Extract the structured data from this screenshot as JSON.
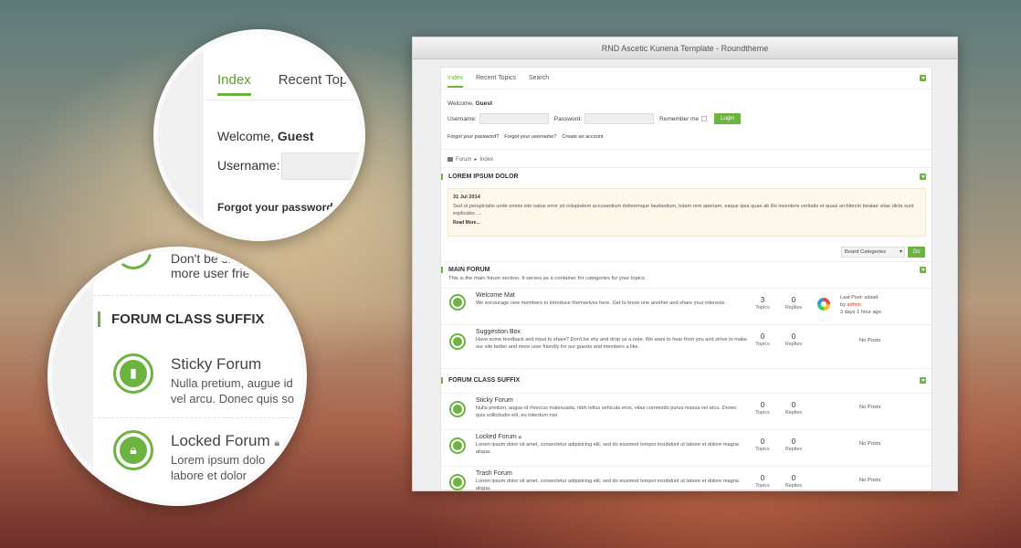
{
  "window": {
    "title": "RND Ascetic Kunena Template - Roundtheme"
  },
  "tabs": [
    {
      "label": "Index"
    },
    {
      "label": "Recent Topics"
    },
    {
      "label": "Search"
    }
  ],
  "login": {
    "welcome_prefix": "Welcome,",
    "welcome_user": "Guest",
    "username_label": "Username:",
    "password_label": "Password:",
    "remember_label": "Remember me",
    "login_button": "Login",
    "forgot_password": "Forgot your password?",
    "forgot_username": "Forgot your username?",
    "create_account": "Create an account"
  },
  "breadcrumb": {
    "forum": "Forum",
    "sep": "▸",
    "index": "Index"
  },
  "announcement": {
    "heading": "LOREM IPSUM DOLOR",
    "date": "31 Jul 2014",
    "text": "Sed ut perspiciatis unde omnis iste natus error sit voluptatem accusantium doloremque laudantium, totam rem aperiam, eaque ipsa quae ab illo inventore veritatis et quasi architecto beatae vitae dicta sunt explicabo. ...",
    "read_more": "Read More..."
  },
  "category_select": {
    "value": "Board Categories",
    "go_button": "Go"
  },
  "sections": [
    {
      "title": "MAIN FORUM",
      "description": "This is the main forum section. It serves as a container for categories for your topics.",
      "forums": [
        {
          "name": "Welcome Mat",
          "desc": "We encourage new members to introduce themselves here. Get to know one another and share your interests.",
          "topics": "3",
          "replies": "0",
          "last_post": "Last Post: sdasd",
          "by": "by",
          "author": "admin",
          "ago": "3 days 1 hour ago"
        },
        {
          "name": "Suggestion Box",
          "desc": "Have some feedback and input to share? Don't be shy and drop us a note. We want to hear from you and strive to make our site better and more user friendly for our guests and members a like.",
          "topics": "0",
          "replies": "0",
          "no_posts": "No Posts"
        }
      ]
    },
    {
      "title": "FORUM CLASS SUFFIX",
      "forums": [
        {
          "name": "Sticky Forum",
          "desc": "Nulla pretium, augue id rhoncus malesuada, nibh tellus vehicula eros, vitae commodo purus massa vel arcu. Donec quis sollicitudin elit, eu interdum nisl",
          "topics": "0",
          "replies": "0",
          "no_posts": "No Posts"
        },
        {
          "name": "Locked Forum",
          "desc": "Lorem ipsum dolor sit amet, consectetur adipisicing elit, sed do eiusmod tempor incididunt ut labore et dolore magna aliqua.",
          "topics": "0",
          "replies": "0",
          "no_posts": "No Posts"
        },
        {
          "name": "Trash Forum",
          "desc": "Lorem ipsum dolor sit amet, consectetur adipisicing elit, sed do eiusmod tempor incididunt ut labore et dolore magna aliqua.",
          "topics": "0",
          "replies": "0",
          "no_posts": "No Posts"
        }
      ]
    }
  ],
  "stat_labels": {
    "topics": "Topics",
    "replies": "Replies"
  },
  "zoom1": {
    "tab_index": "Index",
    "tab_recent": "Recent Topi",
    "welcome_prefix": "Welcome,",
    "welcome_user": "Guest",
    "username_label": "Username:",
    "forgot": "Forgot your password?"
  },
  "zoom2": {
    "top_line1": "Don't be sh",
    "top_line2": "more user frie",
    "section_title": "FORUM CLASS SUFFIX",
    "sticky_name": "Sticky Forum",
    "sticky_line1": "Nulla pretium, augue id",
    "sticky_line2": "vel arcu. Donec quis so",
    "locked_name": "Locked Forum",
    "locked_line1": "Lorem ipsum dolo",
    "locked_line2": "labore et dolor"
  },
  "colors": {
    "accent": "#6cb33f",
    "author": "#c0392b",
    "announce_bg": "#fdf8ea"
  },
  "icons": [
    "bookmark-icon",
    "lock-icon",
    "trash-icon",
    "forum-icon",
    "home-icon",
    "collapse-icon"
  ]
}
